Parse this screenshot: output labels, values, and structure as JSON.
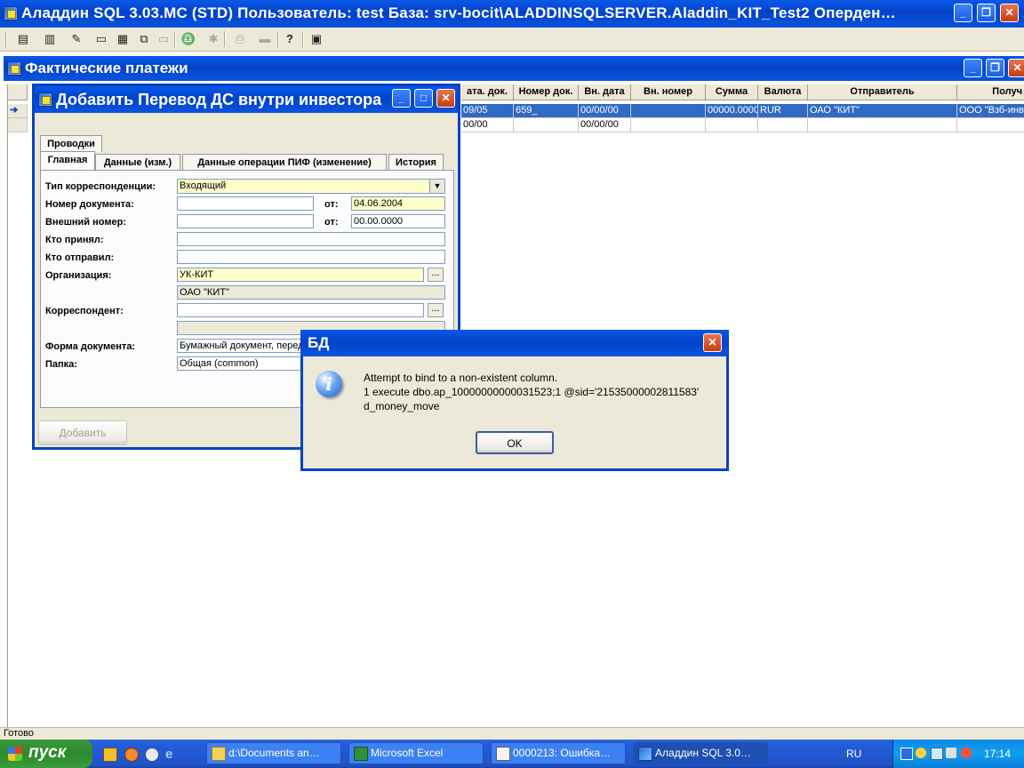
{
  "app": {
    "title": "Аладдин SQL 3.03.MC (STD)  Пользователь: test База: srv-bocit\\ALADDINSQLSERVER.Aladdin_KIT_Test2 Оперден…",
    "minimize": "_",
    "restore": "❐",
    "close": "✕"
  },
  "toolbar": {
    "icons": [
      "notes-icon",
      "binoculars-icon",
      "print-icon",
      "window-icon",
      "tile-icon",
      "cascade-icon",
      "restore-window-icon",
      "find-icon",
      "gear-icon",
      "printer-icon",
      "save-icon",
      "help-icon",
      "calculator-icon"
    ]
  },
  "mdi": {
    "title": "Фактические платежи",
    "minimize": "_",
    "restore": "❐",
    "close": "✕"
  },
  "grid": {
    "columns": [
      "ата. док.",
      "Номер док.",
      "Вн. дата",
      "Вн. номер",
      "Сумма",
      "Валюта",
      "Отправитель",
      "Получ"
    ],
    "rows": [
      [
        "09/05",
        "659_",
        "00/00/00",
        "",
        "00000.0000",
        "RUR",
        "ОАО \"КИТ\"",
        "ООО \"Взб-инв"
      ],
      [
        "00/00",
        "",
        "00/00/00",
        "",
        "",
        "",
        "",
        ""
      ]
    ],
    "row_marker": "➔"
  },
  "dialog": {
    "title": "Добавить Перевод ДС внутри инвестора",
    "minimize": "_",
    "restore": "□",
    "close": "✕",
    "tabs_row1": [
      "Проводки"
    ],
    "tabs_row2": [
      "Главная",
      "Данные (изм.)",
      "Данные операции ПИФ (изменение)",
      "История"
    ],
    "labels": {
      "corr_type": "Тип корреспонденции:",
      "doc_number": "Номер документа:",
      "ext_number": "Внешний номер:",
      "received_by": "Кто принял:",
      "sent_by": "Кто отправил:",
      "organization": "Организация:",
      "correspondent": "Корреспондент:",
      "doc_form": "Форма документа:",
      "folder": "Папка:",
      "from1": "от:",
      "from2": "от:"
    },
    "values": {
      "corr_type": "Входящий",
      "doc_number": "",
      "doc_date": "04.06.2004",
      "ext_number": "",
      "ext_date": "00.00.0000",
      "received_by": "",
      "sent_by": "",
      "organization": "УК-КИТ",
      "organization_name": "ОАО \"КИТ\"",
      "correspondent": "",
      "correspondent_name": "",
      "doc_form": "Бумажный документ, перед",
      "folder": "Общая  (common)"
    },
    "ellipsis": "...",
    "add_button": "Добавить"
  },
  "error": {
    "title": "БД",
    "close": "✕",
    "lines": [
      "Attempt to bind to a non-existent column.",
      "1 execute dbo.ap_10000000000031523;1 @sid='21535000002811583'",
      "d_money_move"
    ],
    "ok": "OK",
    "icon": "i"
  },
  "status": {
    "text": "Готово"
  },
  "taskbar": {
    "start": "пуск",
    "tasks": [
      {
        "label": "d:\\Documents an…",
        "icon": "folder-icon"
      },
      {
        "label": "Microsoft Excel",
        "icon": "excel-icon"
      },
      {
        "label": "0000213: Ошибка…",
        "icon": "document-icon"
      },
      {
        "label": "Аладдин SQL 3.0…",
        "icon": "app-icon"
      }
    ],
    "lang": "RU",
    "clock": "17:14"
  }
}
